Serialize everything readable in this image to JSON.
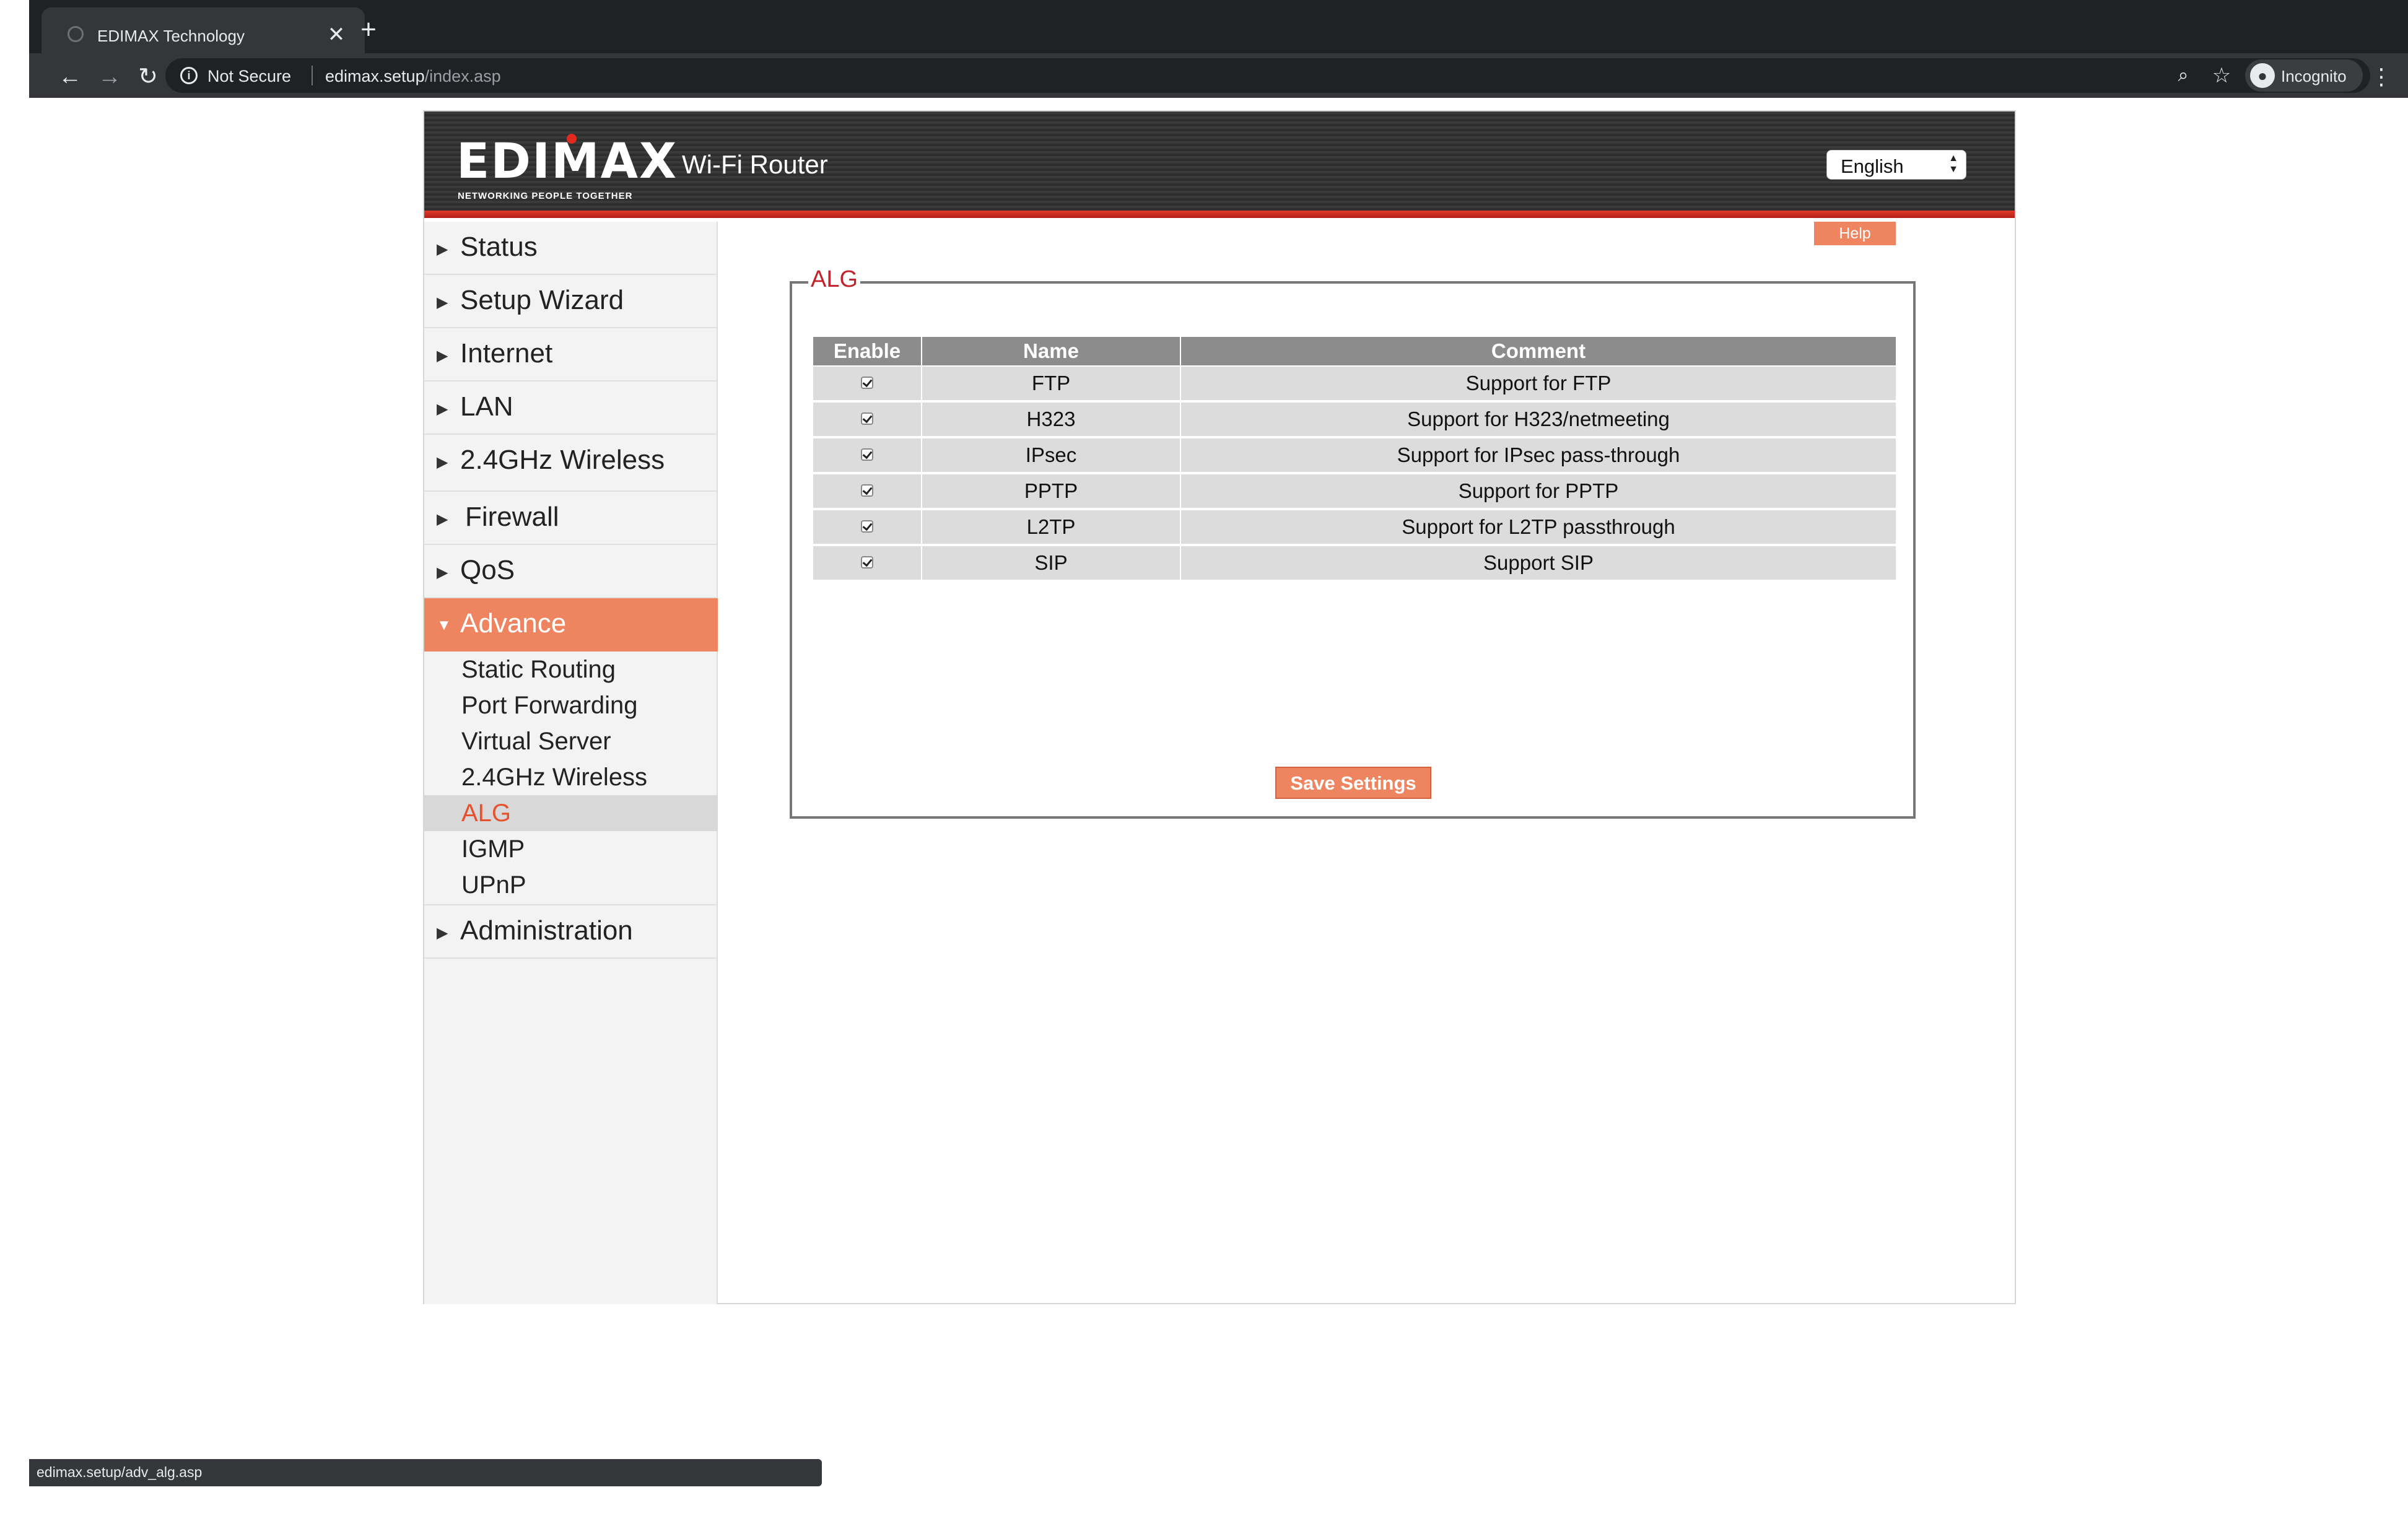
{
  "browser": {
    "tab_title": "EDIMAX Technology",
    "tab_close": "✕",
    "new_tab": "+",
    "back": "←",
    "forward": "→",
    "reload": "↻",
    "security_label": "Not Secure",
    "url_host": "edimax.setup",
    "url_path": "/index.asp",
    "incognito_label": "Incognito",
    "status_url": "edimax.setup/adv_alg.asp"
  },
  "header": {
    "logo_text": "EDIMAX",
    "logo_tagline": "NETWORKING PEOPLE TOGETHER",
    "product_title": "Wi-Fi Router",
    "language": "English"
  },
  "sidebar": {
    "items": [
      {
        "label": "Status"
      },
      {
        "label": "Setup Wizard"
      },
      {
        "label": "Internet"
      },
      {
        "label": "LAN"
      },
      {
        "label": "2.4GHz Wireless"
      },
      {
        "label": "Firewall"
      },
      {
        "label": "QoS"
      },
      {
        "label": "Advance"
      },
      {
        "label": "Administration"
      }
    ],
    "advance_sub": [
      {
        "label": "Static Routing"
      },
      {
        "label": "Port Forwarding"
      },
      {
        "label": "Virtual Server"
      },
      {
        "label": "2.4GHz Wireless"
      },
      {
        "label": "ALG"
      },
      {
        "label": "IGMP"
      },
      {
        "label": "UPnP"
      }
    ]
  },
  "content": {
    "help_label": "Help",
    "section_title": "ALG",
    "columns": [
      "Enable",
      "Name",
      "Comment"
    ],
    "rows": [
      {
        "enabled": true,
        "name": "FTP",
        "comment": "Support for FTP"
      },
      {
        "enabled": true,
        "name": "H323",
        "comment": "Support for H323/netmeeting"
      },
      {
        "enabled": true,
        "name": "IPsec",
        "comment": "Support for IPsec pass-through"
      },
      {
        "enabled": true,
        "name": "PPTP",
        "comment": "Support for PPTP"
      },
      {
        "enabled": true,
        "name": "L2TP",
        "comment": "Support for L2TP passthrough"
      },
      {
        "enabled": true,
        "name": "SIP",
        "comment": "Support SIP"
      }
    ],
    "save_label": "Save Settings"
  },
  "colors": {
    "accent": "#ef8560",
    "header_red": "#e23a2a",
    "legend_red": "#c0232c",
    "selected_sub_text": "#e9512d"
  }
}
